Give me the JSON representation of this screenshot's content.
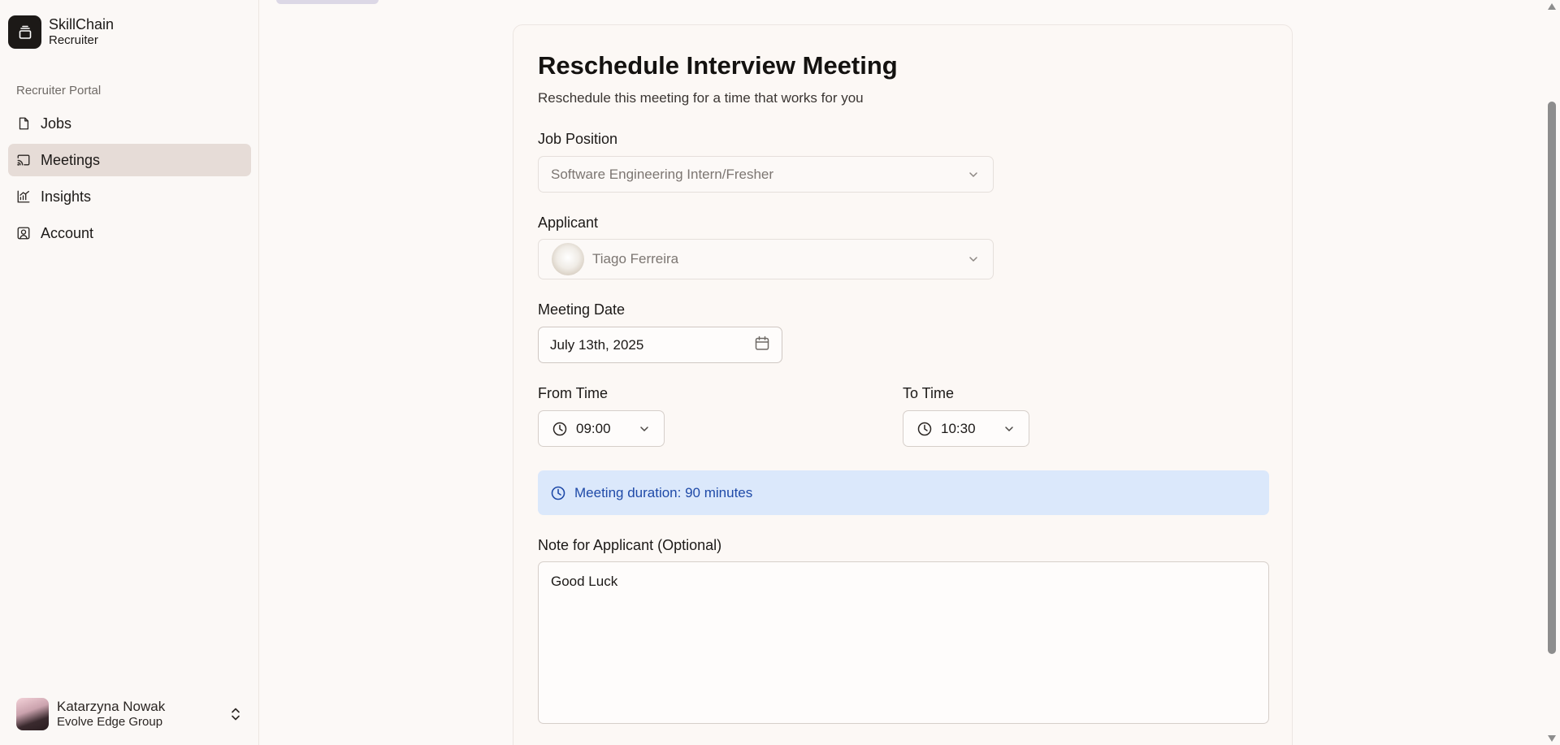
{
  "brand": {
    "name": "SkillChain",
    "subtitle": "Recruiter"
  },
  "sidebar": {
    "group_label": "Recruiter Portal",
    "items": [
      {
        "label": "Jobs",
        "icon": "file-icon",
        "active": false
      },
      {
        "label": "Meetings",
        "icon": "cast-icon",
        "active": true
      },
      {
        "label": "Insights",
        "icon": "chart-icon",
        "active": false
      },
      {
        "label": "Account",
        "icon": "user-square-icon",
        "active": false
      }
    ]
  },
  "user": {
    "name": "Katarzyna Nowak",
    "org": "Evolve Edge Group"
  },
  "form": {
    "title": "Reschedule Interview Meeting",
    "description": "Reschedule this meeting for a time that works for you",
    "job_position": {
      "label": "Job Position",
      "value": "Software Engineering Intern/Fresher"
    },
    "applicant": {
      "label": "Applicant",
      "value": "Tiago Ferreira"
    },
    "meeting_date": {
      "label": "Meeting Date",
      "value": "July 13th, 2025"
    },
    "from_time": {
      "label": "From Time",
      "value": "09:00"
    },
    "to_time": {
      "label": "To Time",
      "value": "10:30"
    },
    "duration_text": "Meeting duration: 90 minutes",
    "note": {
      "label": "Note for Applicant (Optional)",
      "value": "Good Luck"
    }
  },
  "colors": {
    "active_nav": "#e6dcd7",
    "duration_bg": "#dbe8fb",
    "duration_text": "#1f4aa8",
    "brand_logo_bg": "#1c1917"
  }
}
